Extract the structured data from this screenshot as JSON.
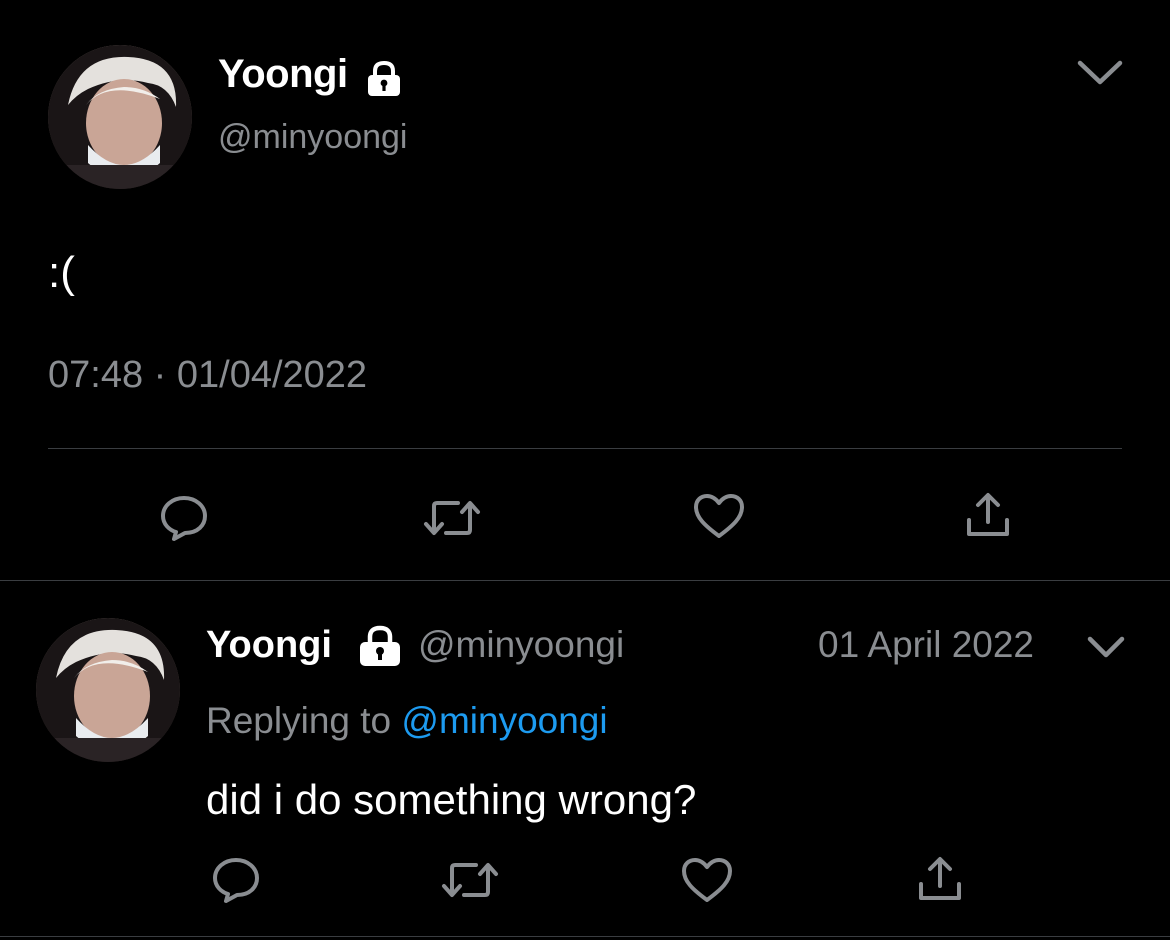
{
  "main_tweet": {
    "display_name": "Yoongi",
    "handle": "@minyoongi",
    "text": ":(",
    "time": "07:48",
    "separator": "·",
    "date": "01/04/2022",
    "avatar_icon": "avatar-photo",
    "protected_icon": "lock-icon",
    "menu_icon": "chevron-down-icon",
    "actions": [
      "reply-icon",
      "retweet-icon",
      "like-icon",
      "share-icon"
    ]
  },
  "reply_tweet": {
    "display_name": "Yoongi",
    "handle": "@minyoongi",
    "date": "01 April 2022",
    "replying_prefix": "Replying to",
    "replying_to": "@minyoongi",
    "text": "did i do something wrong?",
    "avatar_icon": "avatar-photo",
    "protected_icon": "lock-icon",
    "menu_icon": "chevron-down-icon",
    "actions": [
      "reply-icon",
      "retweet-icon",
      "like-icon",
      "share-icon"
    ]
  },
  "colors": {
    "background": "#000000",
    "text": "#ffffff",
    "secondary": "#8a8d91",
    "link": "#1d9bf0",
    "divider": "#3a3d41"
  }
}
